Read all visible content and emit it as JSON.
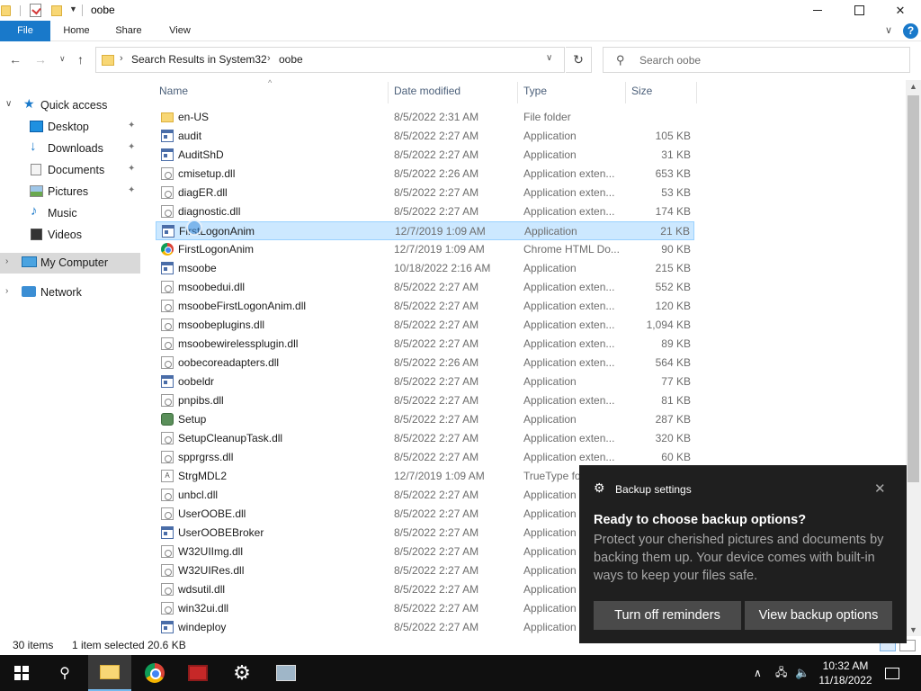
{
  "window": {
    "title": "oobe",
    "controls": {
      "minimize": "",
      "maximize": "",
      "close": "✕"
    }
  },
  "ribbon": {
    "tabs": [
      "File",
      "Home",
      "Share",
      "View"
    ],
    "help": "?",
    "expand": "∨"
  },
  "address": {
    "breadcrumbs": [
      "Search Results in System32",
      "oobe"
    ],
    "separator": "›",
    "dropdown": "∨",
    "refresh": "↻"
  },
  "nav_buttons": {
    "back": "←",
    "forward": "→",
    "recent": "∨",
    "up": "↑"
  },
  "search": {
    "placeholder": "Search oobe",
    "icon": "⚲"
  },
  "sidebar": {
    "items": [
      {
        "label": "Quick access",
        "icon": "star-icon",
        "glyph": "★",
        "chevron": "∨",
        "pinned": false
      },
      {
        "label": "Desktop",
        "icon": "desktop-icon",
        "pinned": true
      },
      {
        "label": "Downloads",
        "icon": "download-icon",
        "glyph": "↓",
        "pinned": true
      },
      {
        "label": "Documents",
        "icon": "document-icon",
        "pinned": true
      },
      {
        "label": "Pictures",
        "icon": "pictures-icon",
        "pinned": true
      },
      {
        "label": "Music",
        "icon": "music-icon",
        "glyph": "♪",
        "pinned": false
      },
      {
        "label": "Videos",
        "icon": "video-icon",
        "pinned": false
      },
      {
        "label": "My Computer",
        "icon": "computer-icon",
        "chevron": "›",
        "selected": true
      },
      {
        "label": "Network",
        "icon": "network-icon",
        "chevron": "›"
      }
    ],
    "pin_glyph": "📌"
  },
  "columns": {
    "name": "Name",
    "date": "Date modified",
    "type": "Type",
    "size": "Size",
    "sort_indicator": "^"
  },
  "files": [
    {
      "name": "en-US",
      "date": "8/5/2022 2:31 AM",
      "type": "File folder",
      "size": "",
      "icon": "folder-icon"
    },
    {
      "name": "audit",
      "date": "8/5/2022 2:27 AM",
      "type": "Application",
      "size": "105 KB",
      "icon": "application-icon"
    },
    {
      "name": "AuditShD",
      "date": "8/5/2022 2:27 AM",
      "type": "Application",
      "size": "31 KB",
      "icon": "application-icon"
    },
    {
      "name": "cmisetup.dll",
      "date": "8/5/2022 2:26 AM",
      "type": "Application exten...",
      "size": "653 KB",
      "icon": "dll-icon"
    },
    {
      "name": "diagER.dll",
      "date": "8/5/2022 2:27 AM",
      "type": "Application exten...",
      "size": "53 KB",
      "icon": "dll-icon"
    },
    {
      "name": "diagnostic.dll",
      "date": "8/5/2022 2:27 AM",
      "type": "Application exten...",
      "size": "174 KB",
      "icon": "dll-icon"
    },
    {
      "name": "FirstLogonAnim",
      "date": "12/7/2019 1:09 AM",
      "type": "Application",
      "size": "21 KB",
      "icon": "application-icon",
      "selected": true
    },
    {
      "name": "FirstLogonAnim",
      "date": "12/7/2019 1:09 AM",
      "type": "Chrome HTML Do...",
      "size": "90 KB",
      "icon": "chrome-html-icon"
    },
    {
      "name": "msoobe",
      "date": "10/18/2022 2:16 AM",
      "type": "Application",
      "size": "215 KB",
      "icon": "application-icon"
    },
    {
      "name": "msoobedui.dll",
      "date": "8/5/2022 2:27 AM",
      "type": "Application exten...",
      "size": "552 KB",
      "icon": "dll-icon"
    },
    {
      "name": "msoobeFirstLogonAnim.dll",
      "date": "8/5/2022 2:27 AM",
      "type": "Application exten...",
      "size": "120 KB",
      "icon": "dll-icon"
    },
    {
      "name": "msoobeplugins.dll",
      "date": "8/5/2022 2:27 AM",
      "type": "Application exten...",
      "size": "1,094 KB",
      "icon": "dll-icon"
    },
    {
      "name": "msoobewirelessplugin.dll",
      "date": "8/5/2022 2:27 AM",
      "type": "Application exten...",
      "size": "89 KB",
      "icon": "dll-icon"
    },
    {
      "name": "oobecoreadapters.dll",
      "date": "8/5/2022 2:26 AM",
      "type": "Application exten...",
      "size": "564 KB",
      "icon": "dll-icon"
    },
    {
      "name": "oobeldr",
      "date": "8/5/2022 2:27 AM",
      "type": "Application",
      "size": "77 KB",
      "icon": "application-icon"
    },
    {
      "name": "pnpibs.dll",
      "date": "8/5/2022 2:27 AM",
      "type": "Application exten...",
      "size": "81 KB",
      "icon": "dll-icon"
    },
    {
      "name": "Setup",
      "date": "8/5/2022 2:27 AM",
      "type": "Application",
      "size": "287 KB",
      "icon": "setup-icon"
    },
    {
      "name": "SetupCleanupTask.dll",
      "date": "8/5/2022 2:27 AM",
      "type": "Application exten...",
      "size": "320 KB",
      "icon": "dll-icon"
    },
    {
      "name": "spprgrss.dll",
      "date": "8/5/2022 2:27 AM",
      "type": "Application exten...",
      "size": "60 KB",
      "icon": "dll-icon"
    },
    {
      "name": "StrgMDL2",
      "date": "12/7/2019 1:09 AM",
      "type": "TrueType fo",
      "size": "",
      "icon": "font-icon"
    },
    {
      "name": "unbcl.dll",
      "date": "8/5/2022 2:27 AM",
      "type": "Application",
      "size": "",
      "icon": "dll-icon"
    },
    {
      "name": "UserOOBE.dll",
      "date": "8/5/2022 2:27 AM",
      "type": "Application",
      "size": "",
      "icon": "dll-icon"
    },
    {
      "name": "UserOOBEBroker",
      "date": "8/5/2022 2:27 AM",
      "type": "Application",
      "size": "",
      "icon": "application-icon"
    },
    {
      "name": "W32UIImg.dll",
      "date": "8/5/2022 2:27 AM",
      "type": "Application",
      "size": "",
      "icon": "dll-icon"
    },
    {
      "name": "W32UIRes.dll",
      "date": "8/5/2022 2:27 AM",
      "type": "Application",
      "size": "",
      "icon": "dll-icon"
    },
    {
      "name": "wdsutil.dll",
      "date": "8/5/2022 2:27 AM",
      "type": "Application",
      "size": "",
      "icon": "dll-icon"
    },
    {
      "name": "win32ui.dll",
      "date": "8/5/2022 2:27 AM",
      "type": "Application",
      "size": "",
      "icon": "dll-icon"
    },
    {
      "name": "windeploy",
      "date": "8/5/2022 2:27 AM",
      "type": "Application",
      "size": "",
      "icon": "application-icon"
    }
  ],
  "status": {
    "items": "30 items",
    "selected": "1 item selected",
    "size": "20.6 KB"
  },
  "scrollbar": {
    "up": "▲",
    "down": "▼"
  },
  "toast": {
    "app": "Backup settings",
    "gear": "⚙",
    "close": "✕",
    "title": "Ready to choose backup options?",
    "body": "Protect your cherished pictures and documents by backing them up. Your device comes with built-in ways to keep your files safe.",
    "button1": "Turn off reminders",
    "button2": "View backup options"
  },
  "taskbar": {
    "search_glyph": "⚲",
    "settings_glyph": "⚙",
    "tray": {
      "chevron": "∧",
      "network": "🖧",
      "volume": "🔈",
      "time": "10:32 AM",
      "date": "11/18/2022"
    }
  },
  "colors": {
    "accent": "#1979ca",
    "selection": "#cce8ff",
    "toast_bg": "#1f1f1f",
    "taskbar_bg": "#101010"
  }
}
